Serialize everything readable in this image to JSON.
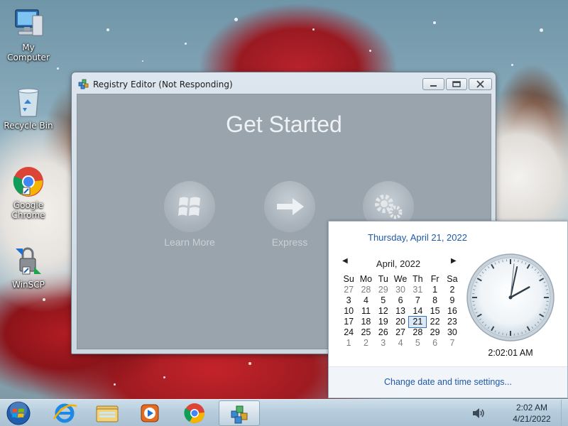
{
  "desktop": {
    "icons": [
      {
        "label": "My Computer",
        "icon": "computer-icon"
      },
      {
        "label": "Recycle Bin",
        "icon": "recycle-bin-icon"
      },
      {
        "label_line1": "Google",
        "label_line2": "Chrome",
        "icon": "chrome-icon"
      },
      {
        "label": "WinSCP",
        "icon": "winscp-icon"
      }
    ]
  },
  "window": {
    "title": "Registry Editor (Not Responding)",
    "heading": "Get Started",
    "items": [
      {
        "label": "Learn More",
        "icon": "windows-logo-icon"
      },
      {
        "label": "Express",
        "icon": "arrow-right-icon"
      },
      {
        "label": "",
        "icon": "gears-icon"
      }
    ],
    "controls": {
      "minimize": "minimize-icon",
      "maximize": "maximize-icon",
      "close": "close-icon"
    }
  },
  "flyout": {
    "long_date": "Thursday, April 21, 2022",
    "month_label": "April, 2022",
    "weekdays": [
      "Su",
      "Mo",
      "Tu",
      "We",
      "Th",
      "Fr",
      "Sa"
    ],
    "weeks": [
      [
        "27",
        "28",
        "29",
        "30",
        "31",
        "1",
        "2"
      ],
      [
        "3",
        "4",
        "5",
        "6",
        "7",
        "8",
        "9"
      ],
      [
        "10",
        "11",
        "12",
        "13",
        "14",
        "15",
        "16"
      ],
      [
        "17",
        "18",
        "19",
        "20",
        "21",
        "22",
        "23"
      ],
      [
        "24",
        "25",
        "26",
        "27",
        "28",
        "29",
        "30"
      ],
      [
        "1",
        "2",
        "3",
        "4",
        "5",
        "6",
        "7"
      ]
    ],
    "other_month_rows": {
      "first_row_prev_count": 5,
      "last_row_all": true
    },
    "today": "21",
    "clock_time": "2:02:01 AM",
    "clock": {
      "hour": 2,
      "minute": 2,
      "second": 1
    },
    "settings_link": "Change date and time settings..."
  },
  "taskbar": {
    "pinned": [
      "internet-explorer-icon",
      "file-explorer-icon",
      "media-player-icon",
      "chrome-icon",
      "registry-editor-icon"
    ],
    "active": "registry-editor-icon",
    "tray_time": "2:02 AM",
    "tray_date": "4/21/2022",
    "volume_icon": "volume-icon"
  }
}
